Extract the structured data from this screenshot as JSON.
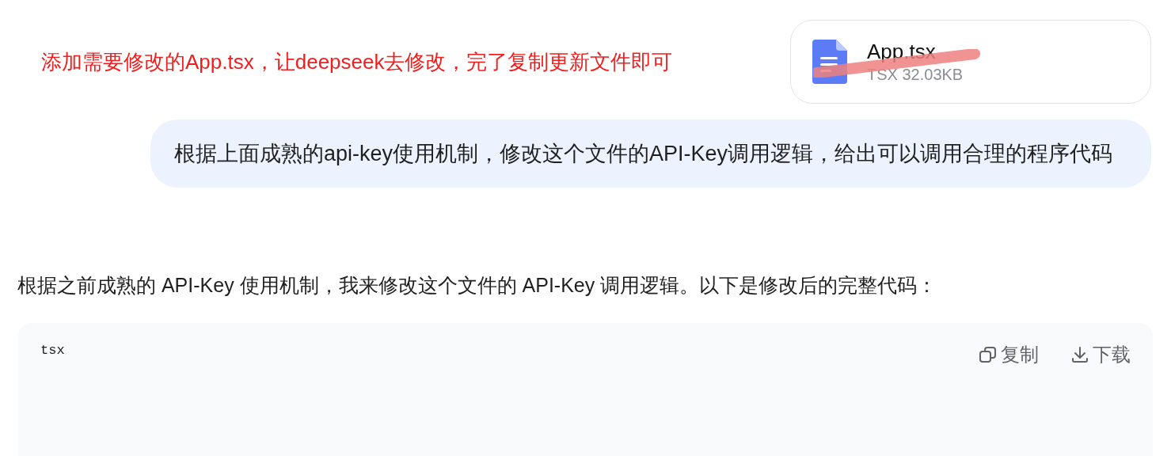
{
  "annotation": {
    "text": "添加需要修改的App.tsx，让deepseek去修改，完了复制更新文件即可"
  },
  "attachment": {
    "name": "App.tsx",
    "meta": "TSX 32.03KB"
  },
  "user_message": {
    "text": "根据上面成熟的api-key使用机制，修改这个文件的API-Key调用逻辑，给出可以调用合理的程序代码"
  },
  "assistant_message": {
    "text": "根据之前成熟的 API-Key 使用机制，我来修改这个文件的 API-Key 调用逻辑。以下是修改后的完整代码："
  },
  "code_block": {
    "language": "tsx",
    "actions": [
      {
        "kind": "copy",
        "label": "复制"
      },
      {
        "kind": "download",
        "label": "下载"
      }
    ]
  }
}
